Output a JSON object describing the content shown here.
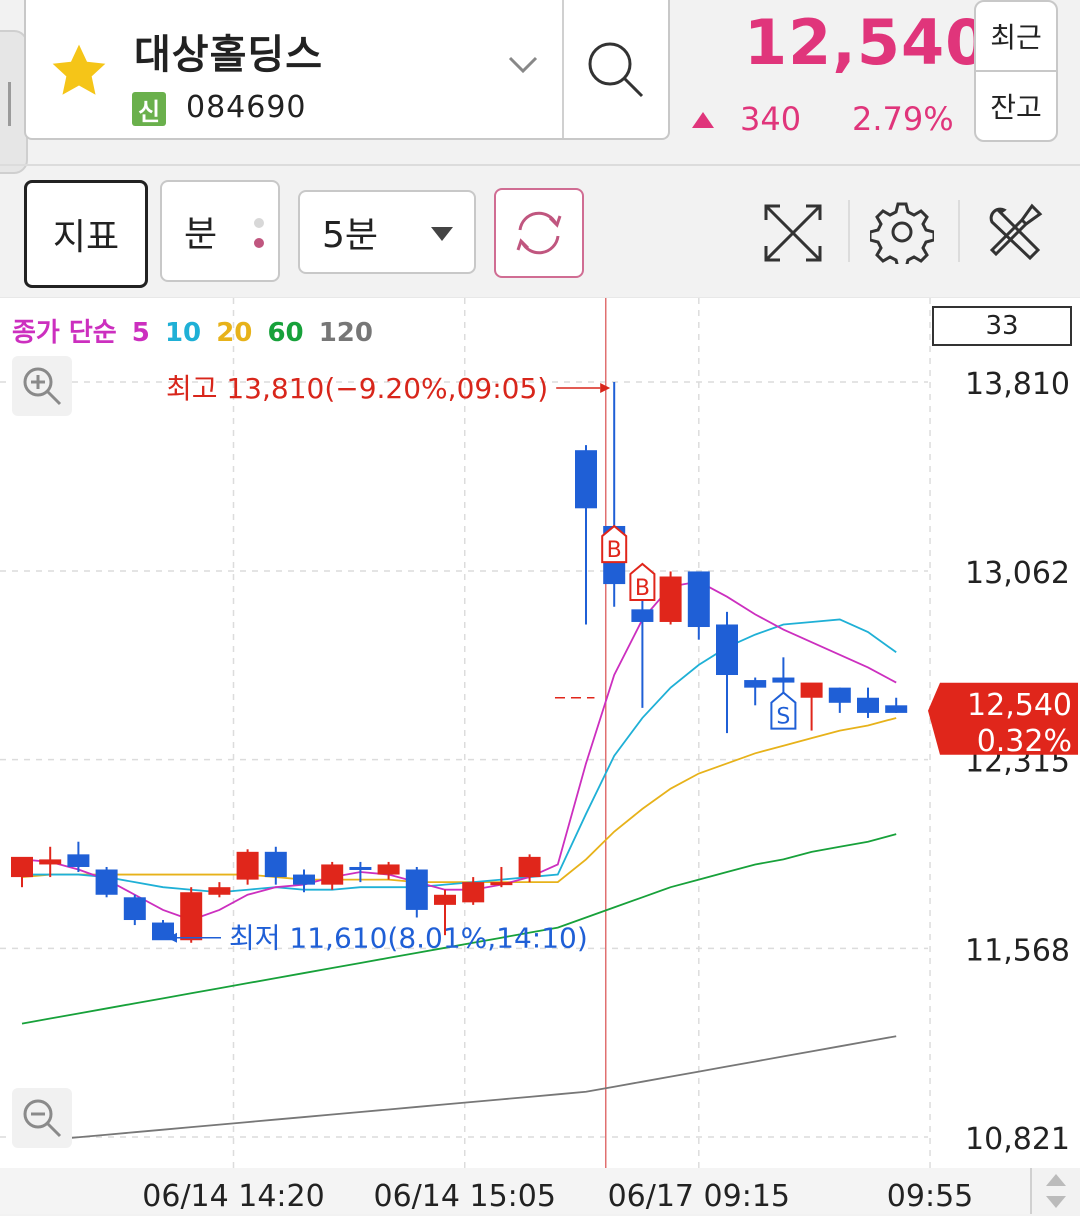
{
  "header": {
    "stock_name": "대상홀딩스",
    "badge": "신",
    "stock_code": "084690",
    "price": "12,540",
    "change": "340",
    "change_pct": "2.79%",
    "btn_recent": "최근",
    "btn_balance": "잔고",
    "favorite_color": "#f5c518",
    "up_color": "#e0357b"
  },
  "toolbar": {
    "indicator_label": "지표",
    "unit_label": "분",
    "interval_value": "5분"
  },
  "legend": {
    "ma_label": "종가 단순",
    "periods": [
      {
        "label": "5",
        "color": "#cc2fbf"
      },
      {
        "label": "10",
        "color": "#1fb0d6"
      },
      {
        "label": "20",
        "color": "#e7b21a"
      },
      {
        "label": "60",
        "color": "#17a13a"
      },
      {
        "label": "120",
        "color": "#777777"
      }
    ]
  },
  "count": "33",
  "chart_data": {
    "type": "candlestick",
    "ylim": [
      10821,
      13810
    ],
    "y_ticks": [
      "13,810",
      "13,062",
      "12,315",
      "11,568",
      "10,821"
    ],
    "y_tick_values": [
      13810,
      13062,
      12315,
      11568,
      10821
    ],
    "x_ticks": [
      "06/14 14:20",
      "06/14 15:05",
      "06/17 09:15",
      "09:55"
    ],
    "current_price_label": "12,540",
    "current_pct_label": "0.32%",
    "current_price": 12540,
    "high_annotation": "최고 13,810(−9.20%,09:05)",
    "low_annotation": "최저 11,610(8.01%,14:10)",
    "up_color": "#e0261b",
    "down_color": "#1f5fd6",
    "candles": [
      {
        "o": 11850,
        "h": 11900,
        "l": 11810,
        "c": 11930
      },
      {
        "o": 11900,
        "h": 11970,
        "l": 11850,
        "c": 11920
      },
      {
        "o": 11940,
        "h": 11990,
        "l": 11870,
        "c": 11890
      },
      {
        "o": 11880,
        "h": 11890,
        "l": 11770,
        "c": 11780
      },
      {
        "o": 11770,
        "h": 11780,
        "l": 11660,
        "c": 11680
      },
      {
        "o": 11670,
        "h": 11680,
        "l": 11610,
        "c": 11600
      },
      {
        "o": 11600,
        "h": 11810,
        "l": 11590,
        "c": 11790
      },
      {
        "o": 11780,
        "h": 11830,
        "l": 11770,
        "c": 11810
      },
      {
        "o": 11840,
        "h": 11960,
        "l": 11820,
        "c": 11950
      },
      {
        "o": 11950,
        "h": 11970,
        "l": 11820,
        "c": 11850
      },
      {
        "o": 11860,
        "h": 11880,
        "l": 11790,
        "c": 11820
      },
      {
        "o": 11820,
        "h": 11910,
        "l": 11800,
        "c": 11900
      },
      {
        "o": 11890,
        "h": 11910,
        "l": 11830,
        "c": 11880
      },
      {
        "o": 11860,
        "h": 11910,
        "l": 11840,
        "c": 11900
      },
      {
        "o": 11880,
        "h": 11890,
        "l": 11690,
        "c": 11720
      },
      {
        "o": 11740,
        "h": 11800,
        "l": 11620,
        "c": 11780
      },
      {
        "o": 11750,
        "h": 11850,
        "l": 11740,
        "c": 11830
      },
      {
        "o": 11830,
        "h": 11890,
        "l": 11810,
        "c": 11830
      },
      {
        "o": 11850,
        "h": 11940,
        "l": 11830,
        "c": 11930
      },
      {
        "o": null,
        "h": null,
        "l": null,
        "c": null
      },
      {
        "o": 13540,
        "h": 13560,
        "l": 12850,
        "c": 13310
      },
      {
        "o": 13240,
        "h": 13810,
        "l": 12920,
        "c": 13010
      },
      {
        "o": 12910,
        "h": 12980,
        "l": 12520,
        "c": 12860
      },
      {
        "o": 12860,
        "h": 13060,
        "l": 12850,
        "c": 13040
      },
      {
        "o": 13060,
        "h": 13060,
        "l": 12790,
        "c": 12840
      },
      {
        "o": 12850,
        "h": 12900,
        "l": 12420,
        "c": 12650
      },
      {
        "o": 12630,
        "h": 12640,
        "l": 12530,
        "c": 12600
      },
      {
        "o": 12640,
        "h": 12720,
        "l": 12570,
        "c": 12620
      },
      {
        "o": 12560,
        "h": 12610,
        "l": 12430,
        "c": 12620
      },
      {
        "o": 12600,
        "h": 12600,
        "l": 12500,
        "c": 12540
      },
      {
        "o": 12560,
        "h": 12600,
        "l": 12480,
        "c": 12500
      },
      {
        "o": 12530,
        "h": 12560,
        "l": 12500,
        "c": 12500
      }
    ],
    "ma5": [
      11920,
      11910,
      11880,
      11840,
      11780,
      11720,
      11680,
      11720,
      11780,
      11810,
      11820,
      11850,
      11870,
      11860,
      11830,
      11800,
      11800,
      11820,
      11850,
      11900,
      12300,
      12650,
      12870,
      13000,
      13020,
      12960,
      12890,
      12830,
      12780,
      12730,
      12680,
      12620
    ],
    "ma10": [
      11860,
      11860,
      11860,
      11850,
      11830,
      11810,
      11800,
      11790,
      11800,
      11810,
      11800,
      11800,
      11810,
      11810,
      11810,
      11820,
      11830,
      11840,
      11850,
      11860,
      12100,
      12330,
      12480,
      12600,
      12690,
      12760,
      12810,
      12850,
      12860,
      12870,
      12820,
      12740
    ],
    "ma20": [
      11850,
      11860,
      11860,
      11860,
      11860,
      11860,
      11860,
      11860,
      11860,
      11850,
      11840,
      11840,
      11840,
      11840,
      11830,
      11830,
      11830,
      11830,
      11830,
      11830,
      11920,
      12030,
      12120,
      12200,
      12260,
      12300,
      12340,
      12370,
      12400,
      12430,
      12450,
      12480
    ],
    "ma60": [
      11270,
      11290,
      11310,
      11330,
      11350,
      11370,
      11390,
      11410,
      11430,
      11450,
      11470,
      11490,
      11510,
      11530,
      11550,
      11570,
      11590,
      11610,
      11630,
      11650,
      11690,
      11730,
      11770,
      11810,
      11840,
      11870,
      11900,
      11920,
      11950,
      11970,
      11990,
      12020
    ],
    "ma120": [
      10800,
      10810,
      10820,
      10830,
      10840,
      10850,
      10860,
      10870,
      10880,
      10890,
      10900,
      10910,
      10920,
      10930,
      10940,
      10950,
      10960,
      10970,
      10980,
      10990,
      11000,
      11020,
      11040,
      11060,
      11080,
      11100,
      11120,
      11140,
      11160,
      11180,
      11200,
      11220
    ],
    "signals": [
      {
        "index": 21,
        "label": "B",
        "at": 13010
      },
      {
        "index": 22,
        "label": "B",
        "at": 12860
      },
      {
        "index": 27,
        "label": "S",
        "at": 12620
      }
    ]
  }
}
